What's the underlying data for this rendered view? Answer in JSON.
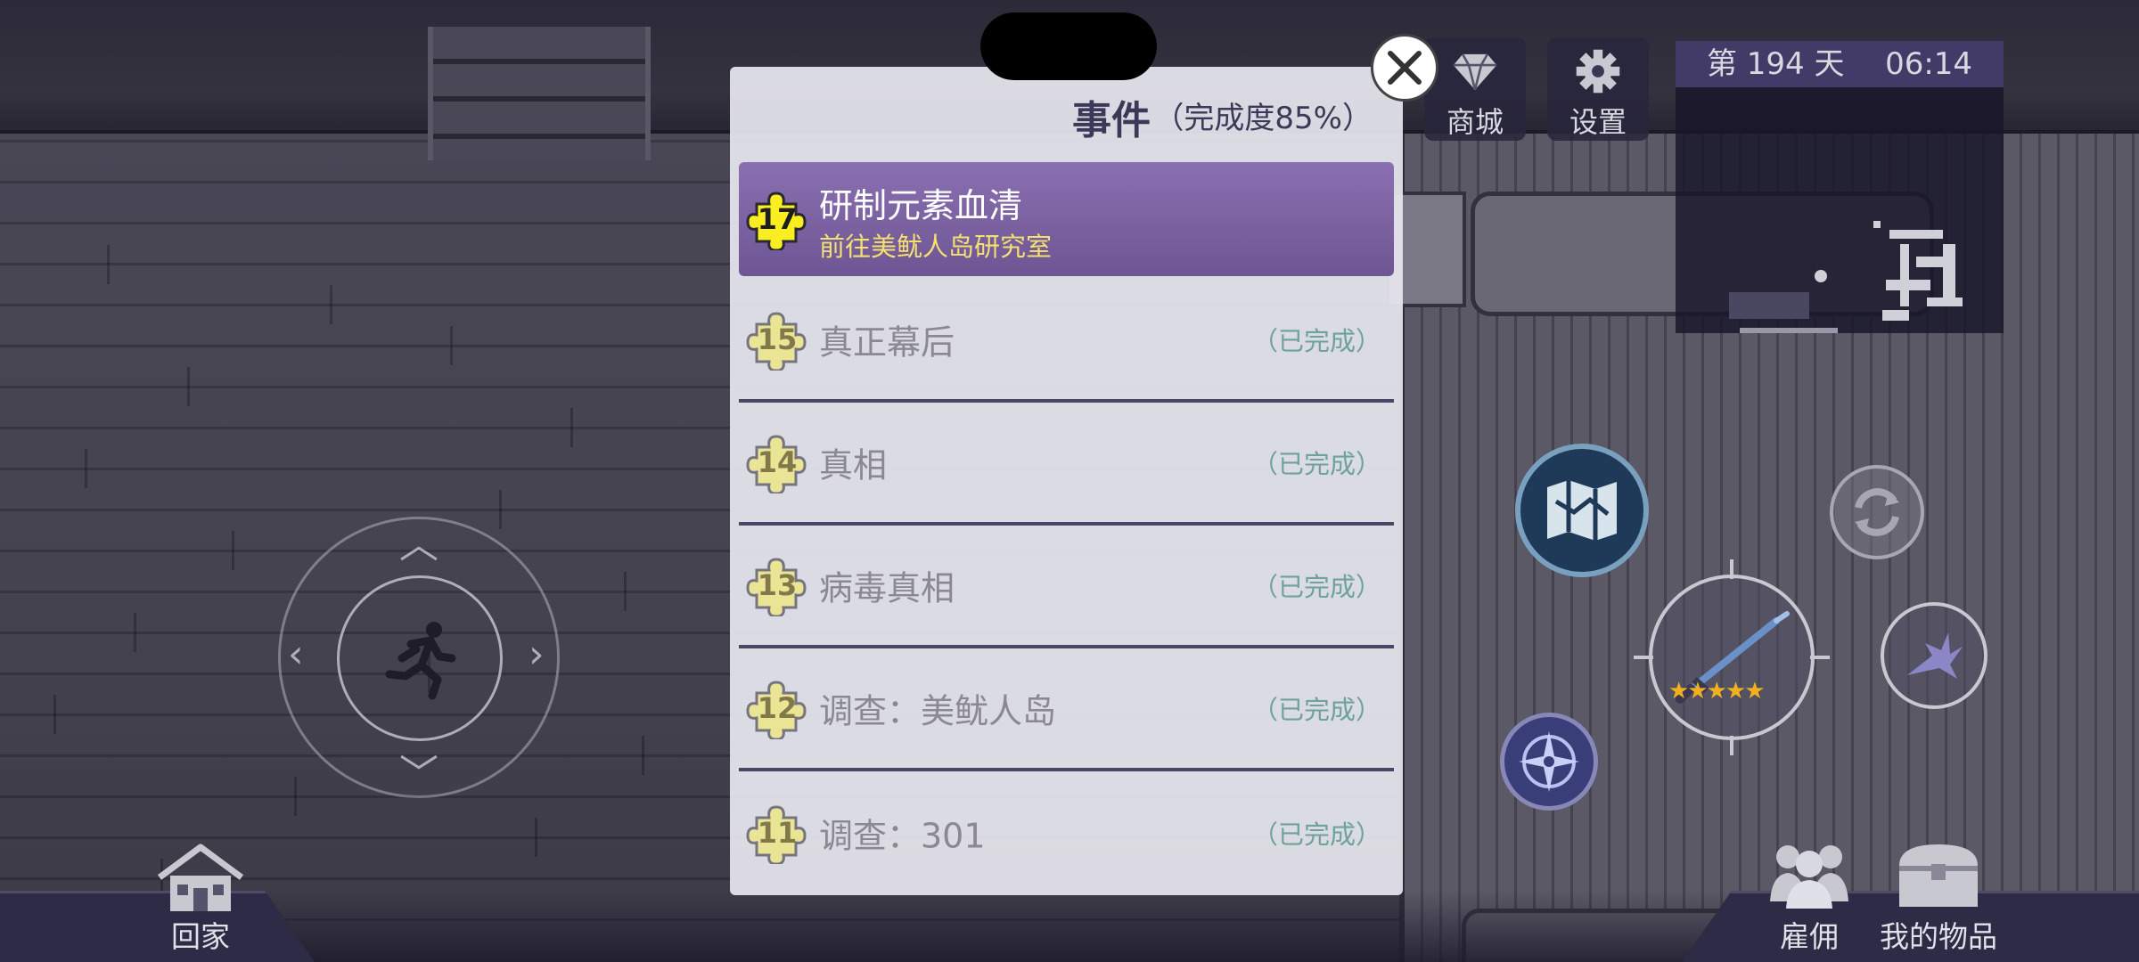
{
  "hud": {
    "shop_label": "商城",
    "settings_label": "设置",
    "day_text": "第 194 天",
    "time_text": "06:14"
  },
  "bottom_nav": {
    "home_label": "回家",
    "hire_label": "雇佣",
    "items_label": "我的物品"
  },
  "weapon": {
    "stars": "★★★★★"
  },
  "dialog": {
    "title": "事件",
    "completion": "（完成度85%）",
    "events": [
      {
        "number": "17",
        "title": "研制元素血清",
        "subtitle": "前往美鱿人岛研究室",
        "status": ""
      },
      {
        "number": "15",
        "title": "真正幕后",
        "status": "（已完成）"
      },
      {
        "number": "14",
        "title": "真相",
        "status": "（已完成）"
      },
      {
        "number": "13",
        "title": "病毒真相",
        "status": "（已完成）"
      },
      {
        "number": "12",
        "title": "调查：美鱿人岛",
        "status": "（已完成）"
      },
      {
        "number": "11",
        "title": "调查：301",
        "status": "（已完成）"
      }
    ]
  },
  "colors": {
    "active_row": "#7b62a2",
    "subtitle": "#f4e070",
    "done_status": "#6ea29a",
    "puzzle_active": "#f8ee20",
    "puzzle_done": "#eee880"
  },
  "icons": {
    "shop": "diamond-icon",
    "settings": "gear-icon",
    "close": "close-icon",
    "home": "house-icon",
    "hire": "people-icon",
    "items": "chest-icon",
    "joystick": "running-man-icon",
    "map": "map-icon",
    "refresh": "refresh-icon",
    "compass": "compass-icon",
    "weapon": "sword-icon",
    "secondary_weapon": "spiked-weapon-icon",
    "event": "puzzle-icon"
  }
}
